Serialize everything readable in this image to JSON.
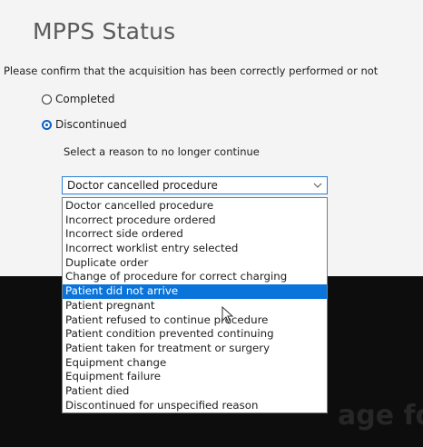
{
  "title": "MPPS Status",
  "prompt": "Please confirm that the acquisition has been correctly performed or not",
  "radios": [
    {
      "label": "Completed",
      "checked": false
    },
    {
      "label": "Discontinued",
      "checked": true
    }
  ],
  "reason_label": "Select a reason to no longer continue",
  "select": {
    "value": "Doctor cancelled procedure",
    "chevron_icon": "chevron-down-icon"
  },
  "options": [
    "Doctor cancelled procedure",
    "Incorrect procedure ordered",
    "Incorrect side ordered",
    "Incorrect worklist entry selected",
    "Duplicate order",
    "Change of procedure for correct charging",
    "Patient did not arrive",
    "Patient pregnant",
    "Patient refused to continue procedure",
    "Patient condition prevented continuing",
    "Patient taken for treatment or surgery",
    "Equipment change",
    "Equipment failure",
    "Patient died",
    "Discontinued for unspecified reason"
  ],
  "highlighted_option": "Patient did not arrive",
  "background_text": "age fo",
  "colors": {
    "accent": "#0a74da",
    "select_border": "#2a7fd4",
    "title": "#5a5a5a"
  }
}
